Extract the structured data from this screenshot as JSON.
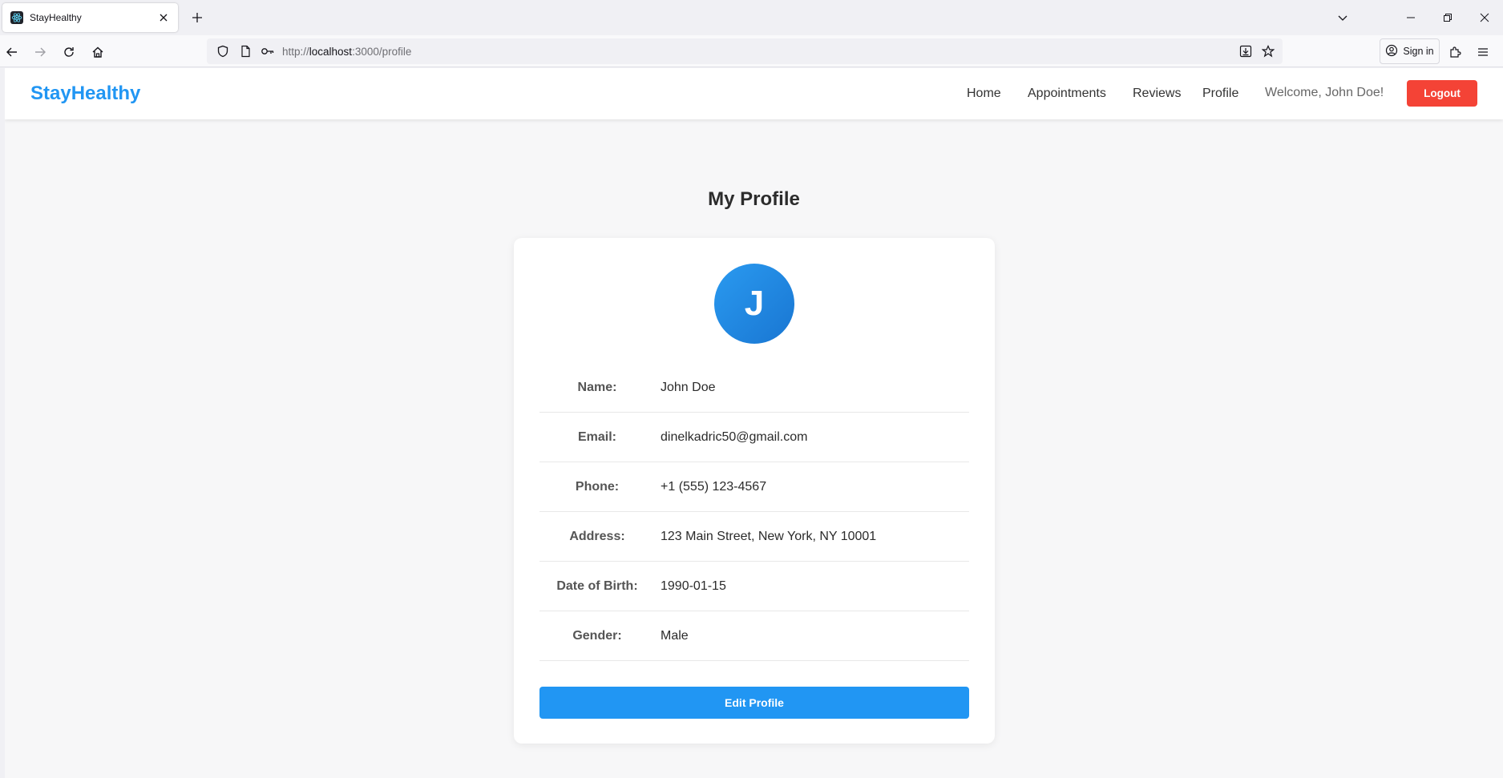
{
  "browser": {
    "tab_title": "StayHealthy",
    "url_prefix": "http://",
    "url_host": "localhost",
    "url_path": ":3000/profile",
    "sign_in_label": "Sign in"
  },
  "header": {
    "brand": "StayHealthy",
    "nav": [
      "Home",
      "Appointments",
      "Reviews",
      "Profile"
    ],
    "welcome": "Welcome, John Doe!",
    "logout_label": "Logout"
  },
  "profile": {
    "title": "My Profile",
    "avatar_initial": "J",
    "fields": [
      {
        "label": "Name:",
        "value": "John Doe"
      },
      {
        "label": "Email:",
        "value": "dinelkadric50@gmail.com"
      },
      {
        "label": "Phone:",
        "value": "+1 (555) 123-4567"
      },
      {
        "label": "Address:",
        "value": "123 Main Street, New York, NY 10001"
      },
      {
        "label": "Date of Birth:",
        "value": "1990-01-15"
      },
      {
        "label": "Gender:",
        "value": "Male"
      }
    ],
    "edit_label": "Edit Profile"
  },
  "colors": {
    "brand": "#2196f3",
    "logout": "#f44336",
    "avatar": "#1e88e5"
  },
  "icons": [
    "react-favicon-icon",
    "close-icon",
    "plus-icon",
    "chevron-down-icon",
    "minimize-icon",
    "restore-icon",
    "close-window-icon",
    "back-icon",
    "forward-icon",
    "reload-icon",
    "home-icon",
    "shield-icon",
    "page-icon",
    "key-icon",
    "download-icon",
    "star-icon",
    "account-icon",
    "extensions-icon",
    "menu-icon"
  ]
}
